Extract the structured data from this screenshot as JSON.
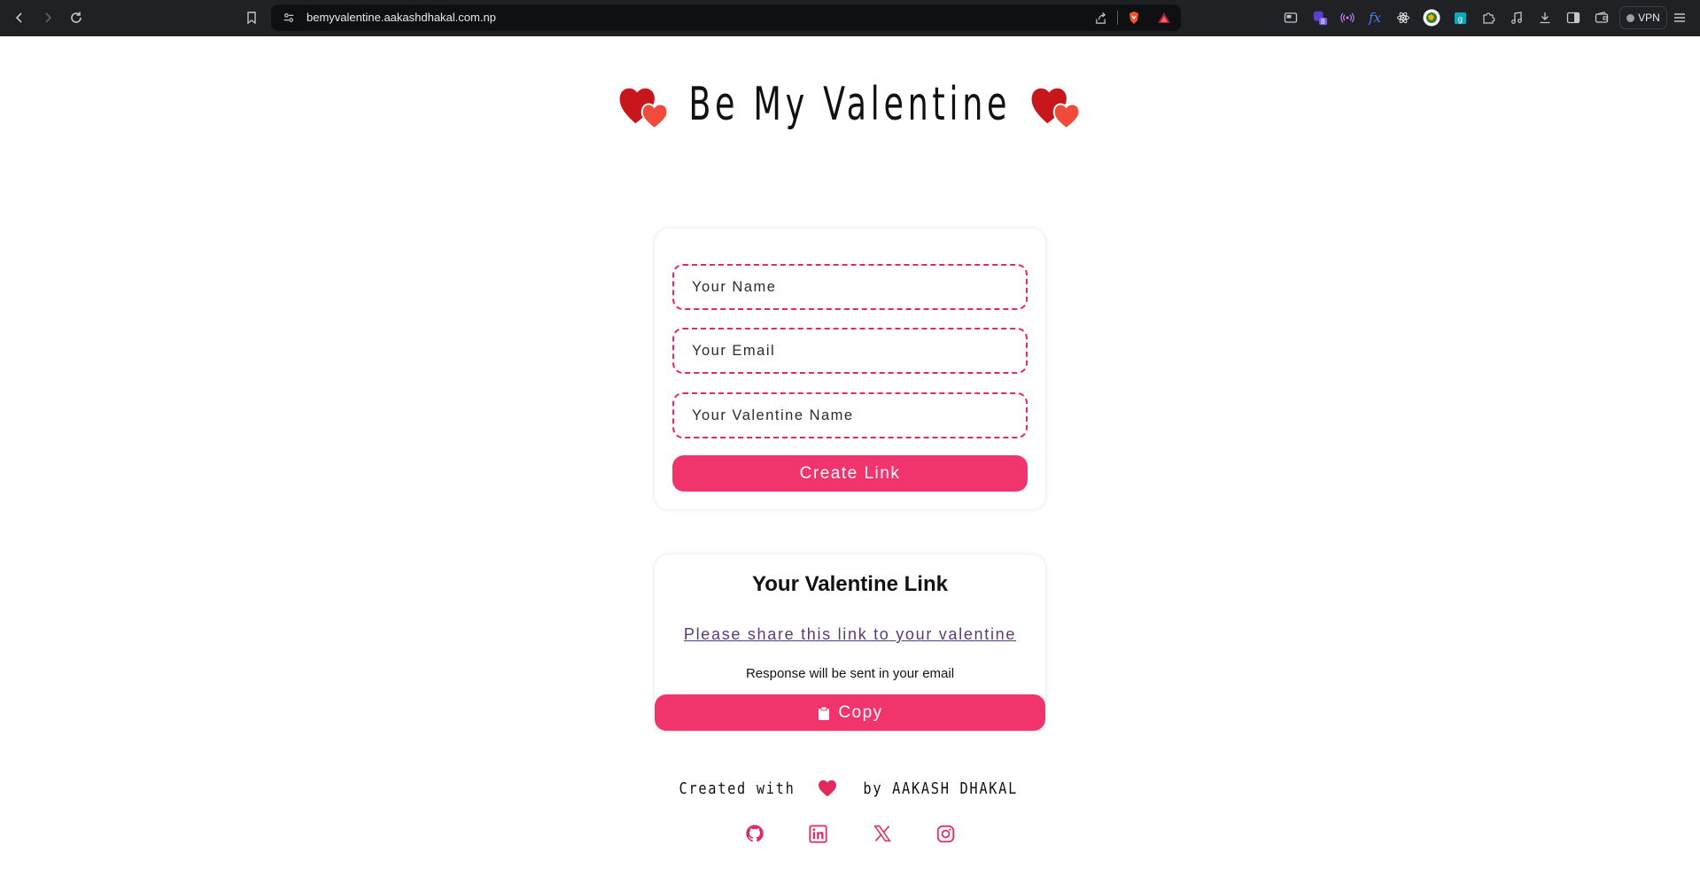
{
  "browser": {
    "url": "bemyvalentine.aakashdhakal.com.np",
    "vpn_label": "VPN",
    "extension_badge": "8"
  },
  "header": {
    "title": "Be My Valentine"
  },
  "form": {
    "name_placeholder": "Your Name",
    "email_placeholder": "Your Email",
    "valentine_placeholder": "Your Valentine Name",
    "create_label": "Create Link"
  },
  "result": {
    "title": "Your Valentine Link",
    "share_text": "Please share this link to your valentine",
    "response_note": "Response will be sent in your email",
    "copy_label": "Copy"
  },
  "footer": {
    "created_with": "Created with",
    "by_text": "by AAKASH DHAKAL",
    "socials": [
      "github-icon",
      "linkedin-icon",
      "x-icon",
      "instagram-icon"
    ]
  },
  "colors": {
    "accent": "#f2346c",
    "field_border": "#e22b5c",
    "heart_dark": "#c8161d",
    "heart_light": "#f04b3a"
  }
}
